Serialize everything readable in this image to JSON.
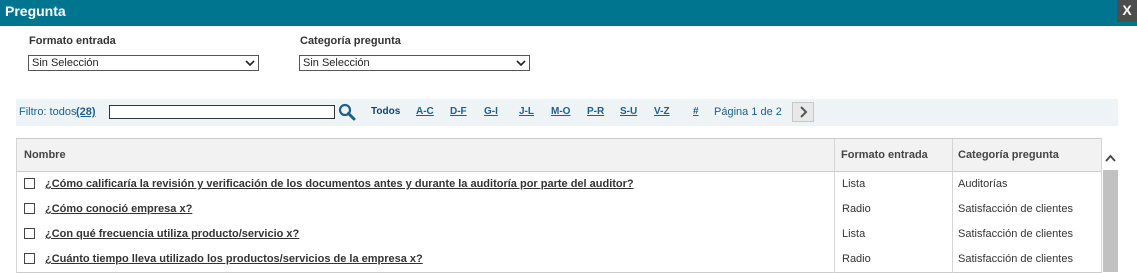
{
  "dialog": {
    "title": "Pregunta",
    "close_label": "X"
  },
  "filters": {
    "formato_label": "Formato entrada",
    "formato_value": "Sin Selección",
    "categoria_label": "Categoría pregunta",
    "categoria_value": "Sin Selección"
  },
  "filterbar": {
    "filtro_label": "Filtro: todos",
    "count": "(28)",
    "letters": [
      "Todos",
      "A-C",
      "D-F",
      "G-I",
      "J-L",
      "M-O",
      "P-R",
      "S-U",
      "V-Z",
      "#"
    ],
    "page_info": "Página 1 de 2",
    "search_icon": "search-icon",
    "next_icon": "chevron-right-icon"
  },
  "table": {
    "columns": [
      "Nombre",
      "Formato entrada",
      "Categoría pregunta"
    ],
    "rows": [
      {
        "nombre": "¿Cómo calificaría la revisión y verificación de los documentos antes y durante la auditoría por parte del auditor?",
        "formato": "Lista",
        "categoria": "Auditorías"
      },
      {
        "nombre": "¿Cómo conoció empresa x?",
        "formato": "Radio",
        "categoria": "Satisfacción de clientes"
      },
      {
        "nombre": "¿Con qué frecuencia utiliza producto/servicio x?",
        "formato": "Lista",
        "categoria": "Satisfacción de clientes"
      },
      {
        "nombre": "¿Cuánto tiempo lleva utilizado los productos/servicios de la empresa x?",
        "formato": "Radio",
        "categoria": "Satisfacción de clientes"
      }
    ]
  },
  "colors": {
    "titlebar": "#00758f",
    "close_button": "#4d4d4d",
    "link": "#1f5f8b",
    "filterbar_bg": "#eef4f6"
  }
}
